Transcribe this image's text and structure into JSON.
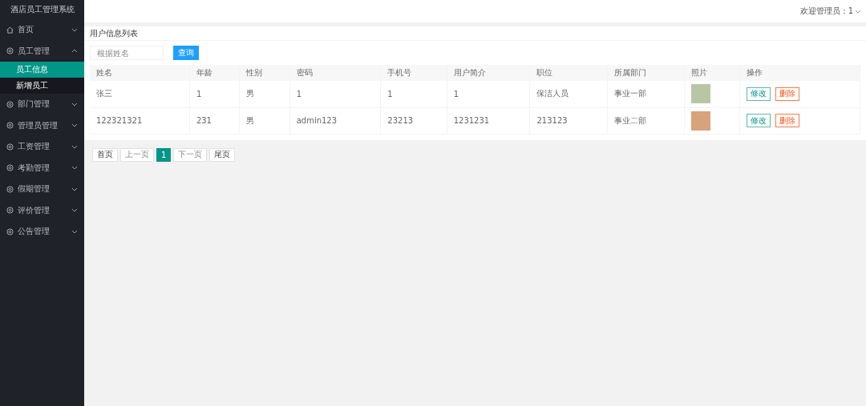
{
  "sidebar": {
    "title": "酒店员工管理系统",
    "items": [
      {
        "label": "首页",
        "kind": "home",
        "expanded": false
      },
      {
        "label": "员工管理",
        "kind": "group",
        "expanded": true,
        "children": [
          {
            "label": "员工信息",
            "selected": true
          },
          {
            "label": "新增员工",
            "selected": false
          }
        ]
      },
      {
        "label": "部门管理",
        "kind": "group",
        "expanded": false
      },
      {
        "label": "管理员管理",
        "kind": "group",
        "expanded": false
      },
      {
        "label": "工资管理",
        "kind": "group",
        "expanded": false
      },
      {
        "label": "考勤管理",
        "kind": "group",
        "expanded": false
      },
      {
        "label": "假期管理",
        "kind": "group",
        "expanded": false
      },
      {
        "label": "评价管理",
        "kind": "group",
        "expanded": false
      },
      {
        "label": "公告管理",
        "kind": "group",
        "expanded": false
      }
    ]
  },
  "header": {
    "welcome": "欢迎管理员：1"
  },
  "panel": {
    "title": "用户信息列表",
    "search": {
      "placeholder": "根据姓名"
    },
    "search_button": "查询"
  },
  "table": {
    "columns": [
      "姓名",
      "年龄",
      "性别",
      "密码",
      "手机号",
      "用户简介",
      "职位",
      "所属部门",
      "照片",
      "操作"
    ],
    "rows": [
      {
        "cells": [
          "张三",
          "1",
          "男",
          "1",
          "1",
          "1",
          "保洁人员",
          "事业一部"
        ],
        "actions": [
          "修改",
          "删除"
        ]
      },
      {
        "cells": [
          "122321321",
          "231",
          "男",
          "admin123",
          "23213",
          "1231231",
          "213123",
          "事业二部"
        ],
        "actions": [
          "修改",
          "删除"
        ]
      }
    ]
  },
  "pagination": [
    {
      "label": "首页",
      "selected": false,
      "disabled": false
    },
    {
      "label": "上一页",
      "selected": false,
      "disabled": true
    },
    {
      "label": "1",
      "selected": true,
      "disabled": false
    },
    {
      "label": "下一页",
      "selected": false,
      "disabled": true
    },
    {
      "label": "尾页",
      "selected": false,
      "disabled": false
    }
  ]
}
